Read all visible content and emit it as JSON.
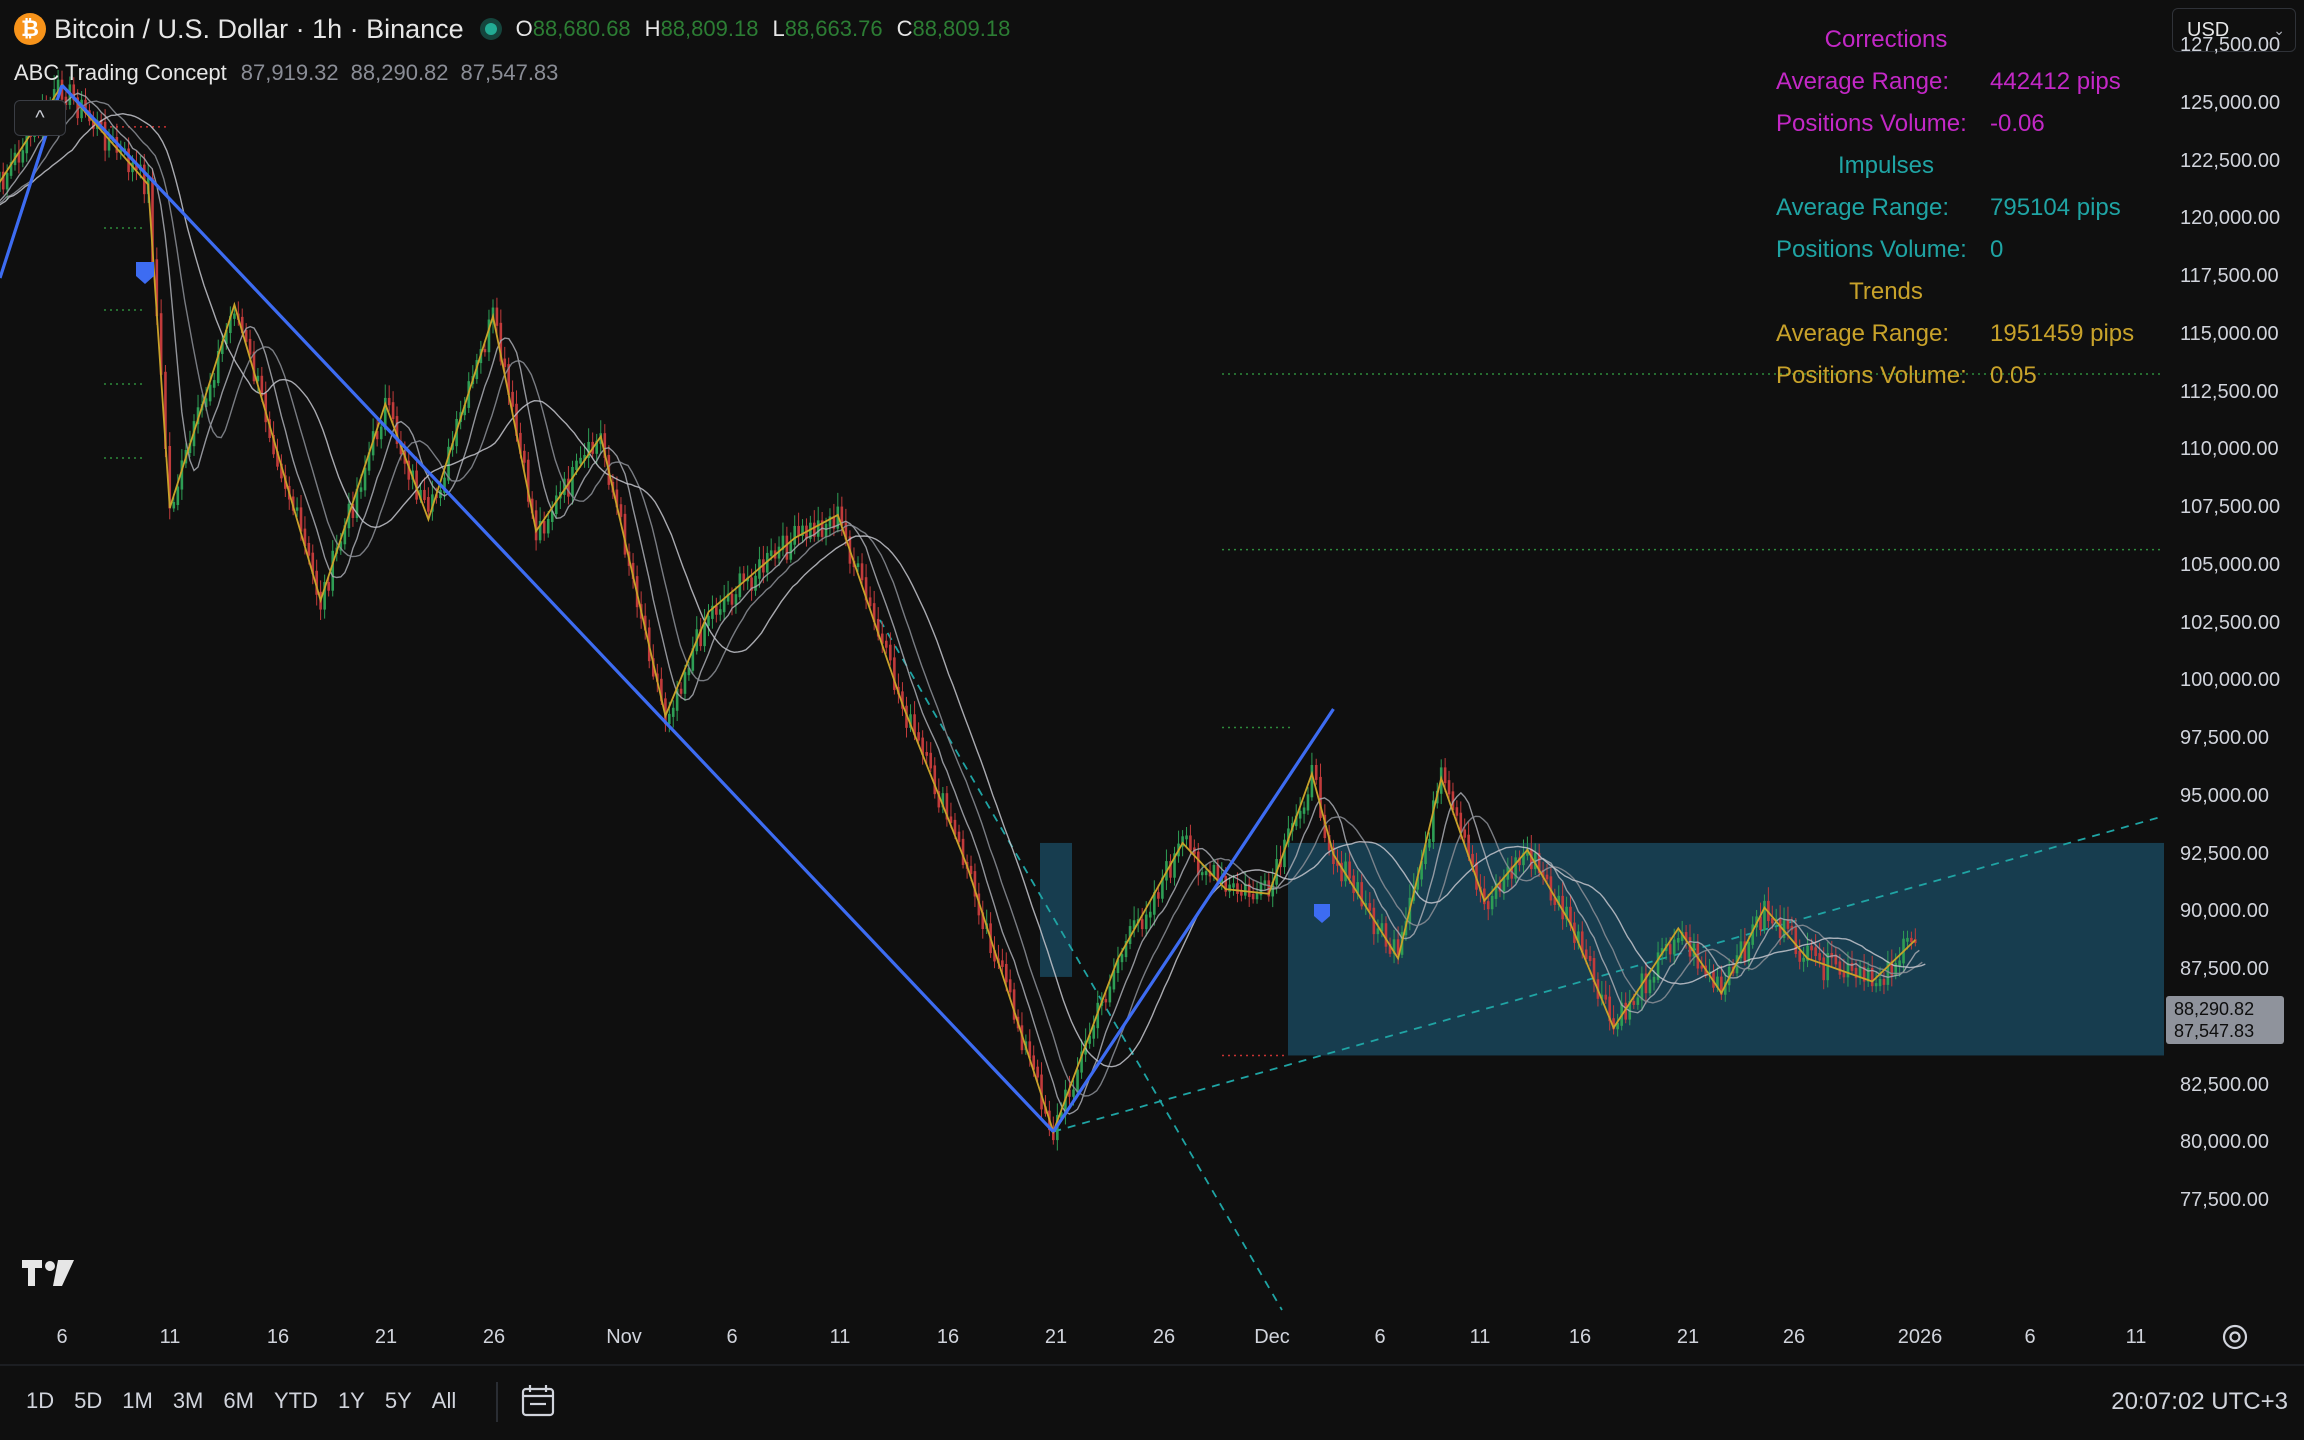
{
  "header": {
    "coin_glyph": "₿",
    "symbol_title": "Bitcoin / U.S. Dollar · 1h · Binance",
    "ohlc": [
      {
        "label": "O",
        "value": "88,680.68"
      },
      {
        "label": "H",
        "value": "88,809.18"
      },
      {
        "label": "L",
        "value": "88,663.76"
      },
      {
        "label": "C",
        "value": "88,809.18"
      }
    ],
    "indicator": {
      "name": "ABC Trading Concept",
      "values": [
        "87,919.32",
        "88,290.82",
        "87,547.83"
      ]
    },
    "collapse_glyph": "^"
  },
  "stats": {
    "corrections": {
      "title": "Corrections",
      "range_label": "Average Range:",
      "range_value": "442412 pips",
      "volume_label": "Positions Volume:",
      "volume_value": "-0.06"
    },
    "impulses": {
      "title": "Impulses",
      "range_label": "Average Range:",
      "range_value": "795104 pips",
      "volume_label": "Positions Volume:",
      "volume_value": "0"
    },
    "trends": {
      "title": "Trends",
      "range_label": "Average Range:",
      "range_value": "1951459 pips",
      "volume_label": "Positions Volume:",
      "volume_value": "0.05"
    }
  },
  "currency": {
    "value": "USD",
    "chevron": "⌄"
  },
  "price_scale": [
    "127,500.00",
    "125,000.00",
    "122,500.00",
    "120,000.00",
    "117,500.00",
    "115,000.00",
    "112,500.00",
    "110,000.00",
    "107,500.00",
    "105,000.00",
    "102,500.00",
    "100,000.00",
    "97,500.00",
    "95,000.00",
    "92,500.00",
    "90,000.00",
    "87,500.00",
    "85,000.00",
    "82,500.00",
    "80,000.00",
    "77,500.00"
  ],
  "price_tag": {
    "top": "88,290.82",
    "bottom": "87,547.83"
  },
  "time_scale": [
    "6",
    "11",
    "16",
    "21",
    "26",
    "Nov",
    "6",
    "11",
    "16",
    "21",
    "26",
    "Dec",
    "6",
    "11",
    "16",
    "21",
    "26",
    "2026",
    "6",
    "11"
  ],
  "bottom_bar": {
    "ranges": [
      "1D",
      "5D",
      "1M",
      "3M",
      "6M",
      "YTD",
      "1Y",
      "5Y",
      "All"
    ],
    "clock": "20:07:02 UTC+3"
  },
  "colors": {
    "background": "#0f0f0f",
    "trend_line": "#3d6cf2",
    "zigzag": "#c8a22a",
    "range_box": "#1b4d66",
    "dashed_cyan": "#1fa4a4",
    "level_green": "#2e8b3c",
    "level_red": "#c83232",
    "corrections": "#c328c6",
    "impulses": "#1fa4a4",
    "trends": "#c8a22a"
  },
  "chart_data": {
    "type": "line",
    "symbol": "BTCUSD",
    "interval": "1h",
    "ylim": [
      76000,
      128500
    ],
    "series": [
      {
        "x": [
          "Oct 2",
          "Oct 6",
          "Oct 10",
          "Oct 11",
          "Oct 14",
          "Oct 18",
          "Oct 21",
          "Oct 23",
          "Oct 26",
          "Oct 28",
          "Oct 31",
          "Nov 3",
          "Nov 5",
          "Nov 9",
          "Nov 11",
          "Nov 14",
          "Nov 17",
          "Nov 21",
          "Nov 24",
          "Nov 27",
          "Nov 29",
          "Dec 1",
          "Dec 3",
          "Dec 4",
          "Dec 7",
          "Dec 9",
          "Dec 11",
          "Dec 13",
          "Dec 15",
          "Dec 17",
          "Dec 20",
          "Dec 22",
          "Dec 24",
          "Dec 26",
          "Dec 29",
          "Dec 31"
        ],
        "values": [
          120000,
          125800,
          121500,
          107500,
          116300,
          103500,
          112000,
          107000,
          115800,
          106500,
          110600,
          98500,
          103000,
          106200,
          107200,
          99000,
          92000,
          80500,
          88000,
          93000,
          91000,
          90800,
          96000,
          92500,
          88000,
          95800,
          90500,
          92700,
          89500,
          85000,
          89300,
          86500,
          90200,
          88000,
          87000,
          88800
        ]
      }
    ],
    "trend_lines": [
      {
        "from": [
          "Oct 6",
          125800
        ],
        "to": [
          "Nov 21",
          80500
        ]
      },
      {
        "from": [
          "Nov 21",
          80500
        ],
        "to": [
          "Dec 4",
          98800
        ]
      }
    ],
    "range_box": {
      "x": [
        "Dec 1",
        "Dec 31"
      ],
      "y": [
        83800,
        93000
      ]
    },
    "levels_green": [
      113300,
      105700,
      98000
    ],
    "levels_red": [
      124000,
      83800
    ]
  }
}
